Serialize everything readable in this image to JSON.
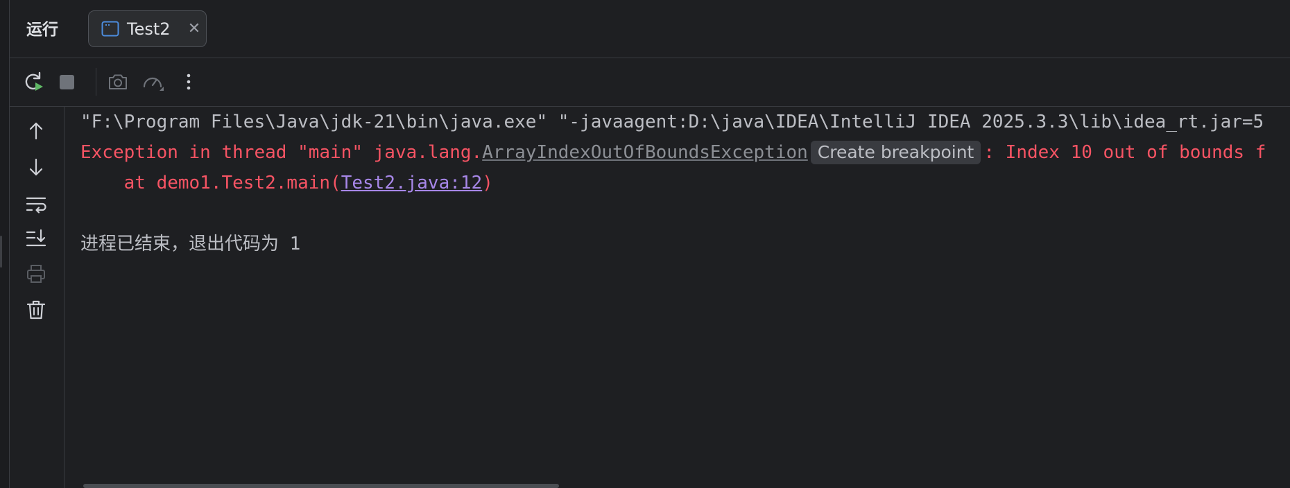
{
  "header": {
    "title": "运行",
    "tab": {
      "label": "Test2",
      "icon": "console-window-icon",
      "close_icon": "close-icon"
    }
  },
  "toolbar": {
    "items": [
      {
        "name": "rerun-button",
        "icon": "rerun-icon"
      },
      {
        "name": "stop-button",
        "icon": "stop-icon"
      },
      {
        "name": "screenshot-button",
        "icon": "camera-icon"
      },
      {
        "name": "profiler-button",
        "icon": "gauge-icon"
      },
      {
        "name": "more-button",
        "icon": "more-vertical-icon"
      }
    ]
  },
  "side_actions": [
    {
      "name": "scroll-up-button",
      "icon": "arrow-up-icon"
    },
    {
      "name": "scroll-down-button",
      "icon": "arrow-down-icon"
    },
    {
      "name": "soft-wrap-button",
      "icon": "soft-wrap-icon"
    },
    {
      "name": "scroll-to-end-button",
      "icon": "scroll-to-end-icon"
    },
    {
      "name": "print-button",
      "icon": "print-icon"
    },
    {
      "name": "clear-button",
      "icon": "trash-icon"
    }
  ],
  "console": {
    "command_line": "\"F:\\Program Files\\Java\\jdk-21\\bin\\java.exe\" \"-javaagent:D:\\java\\IDEA\\IntelliJ IDEA 2025.3.3\\lib\\idea_rt.jar=5",
    "exception": {
      "prefix": "Exception in thread \"main\" java.lang.",
      "class_link": "ArrayIndexOutOfBoundsException",
      "breakpoint_label": "Create breakpoint",
      "suffix": ": Index 10 out of bounds f"
    },
    "stack_frame": {
      "prefix": "    at demo1.Test2.main(",
      "link": "Test2.java:12",
      "suffix": ")"
    },
    "exit_message": "进程已结束，退出代码为 1"
  },
  "colors": {
    "background": "#1e1f22",
    "error": "#f75464",
    "link": "#a787e8",
    "run_green": "#5fb865"
  }
}
